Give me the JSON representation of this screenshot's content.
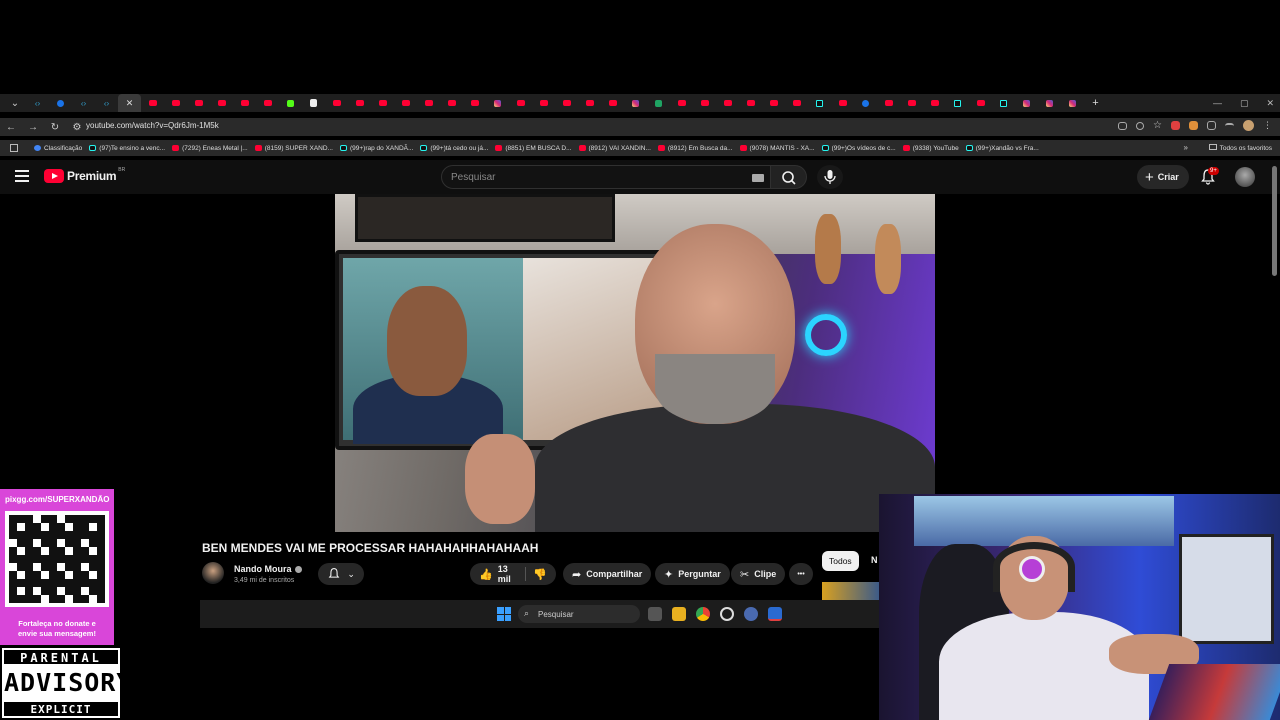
{
  "browser": {
    "url": "youtube.com/watch?v=Qdr6Jm-1M5k",
    "tabs": [
      "cd",
      "bl",
      "cd",
      "cd",
      "x",
      "yt",
      "yt",
      "yt",
      "yt",
      "yt",
      "yt",
      "k",
      "doc",
      "yt",
      "yt",
      "yt",
      "yt",
      "yt",
      "yt",
      "yt",
      "ig",
      "yt",
      "yt",
      "yt",
      "yt",
      "yt",
      "ig",
      "gr",
      "yt",
      "yt",
      "yt",
      "yt",
      "yt",
      "yt",
      "tk",
      "yt",
      "bl",
      "yt",
      "yt",
      "yt",
      "tk",
      "yt",
      "tk",
      "ig",
      "ig",
      "ig"
    ],
    "new_tab": "+",
    "bookmarks": [
      {
        "label": "Classificação",
        "icon": "gc"
      },
      {
        "label": "(97)Te ensino a venc...",
        "icon": "tk"
      },
      {
        "label": "(7292) Eneas Metal |...",
        "icon": "yt"
      },
      {
        "label": "(8159) SUPER XAND...",
        "icon": "yt"
      },
      {
        "label": "(99+)rap do XANDÃ...",
        "icon": "tk"
      },
      {
        "label": "(99+)tá cedo ou já...",
        "icon": "tk"
      },
      {
        "label": "(8851) EM BUSCA D...",
        "icon": "yt"
      },
      {
        "label": "(8912) VAI XANDIN...",
        "icon": "yt"
      },
      {
        "label": "(8912) Em Busca da...",
        "icon": "yt"
      },
      {
        "label": "(9078) MANTIS - XA...",
        "icon": "yt"
      },
      {
        "label": "(99+)Os vídeos de c...",
        "icon": "tk"
      },
      {
        "label": "(9338) YouTube",
        "icon": "yt"
      },
      {
        "label": "(99+)Xandão vs Fra...",
        "icon": "tk"
      }
    ],
    "bookmarks_more": "»",
    "all_bookmarks": "Todos os favoritos"
  },
  "youtube": {
    "logo_text": "Premium",
    "logo_region": "BR",
    "search_placeholder": "Pesquisar",
    "create_label": "Criar",
    "notification_badge": "9+"
  },
  "video": {
    "title": "BEN MENDES VAI ME PROCESSAR HAHAHAHHAHAHAAH",
    "channel_name": "Nando Moura",
    "subscribers": "3,49 mi de inscritos",
    "likes": "13 mil",
    "share_label": "Compartilhar",
    "ask_label": "Perguntar",
    "clip_label": "Clipe",
    "more_label": "•••"
  },
  "chips": {
    "all": "Todos",
    "next": "N"
  },
  "taskbar": {
    "search_placeholder": "Pesquisar"
  },
  "overlay": {
    "donate_url": "pixgg.com/SUPERXANDÃO",
    "donate_message_line1": "Fortaleça no donate e",
    "donate_message_line2": "envie sua mensagem!",
    "advisory_top": "PARENTAL",
    "advisory_mid": "ADVISORY",
    "advisory_bottom": "EXPLICIT CONTENT"
  },
  "colors": {
    "youtube_red": "#ff0033",
    "donate_bg": "#d946d9",
    "page_bg": "#0f0f0f"
  }
}
